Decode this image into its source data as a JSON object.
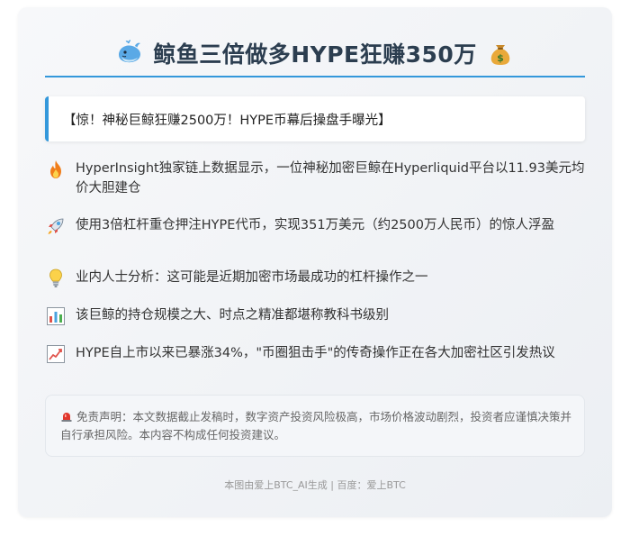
{
  "header": {
    "title": "鲸鱼三倍做多HYPE狂赚350万",
    "left_icon": "whale-icon",
    "right_icon": "money-bag-icon"
  },
  "headline": {
    "text": "【惊！神秘巨鲸狂赚2500万！HYPE币幕后操盘手曝光】"
  },
  "bullets": [
    {
      "icon": "fire-icon",
      "text": "HyperInsight独家链上数据显示，一位神秘加密巨鲸在Hyperliquid平台以11.93美元均价大胆建仓"
    },
    {
      "icon": "rocket-icon",
      "text": "使用3倍杠杆重仓押注HYPE代币，实现351万美元（约2500万人民币）的惊人浮盈"
    },
    {
      "icon": "lightbulb-icon",
      "text": "业内人士分析：这可能是近期加密市场最成功的杠杆操作之一"
    },
    {
      "icon": "bar-chart-icon",
      "text": "该巨鲸的持仓规模之大、时点之精准都堪称教科书级别"
    },
    {
      "icon": "trend-up-chart-icon",
      "text": "HYPE自上市以来已暴涨34%，\"币圈狙击手\"的传奇操作正在各大加密社区引发热议"
    }
  ],
  "disclaimer": {
    "icon": "siren-icon",
    "text": "免责声明：本文数据截止发稿时，数字资产投资风险极高，市场价格波动剧烈，投资者应谨慎决策并自行承担风险。本内容不构成任何投资建议。"
  },
  "footer": {
    "text": "本图由爱上BTC_AI生成 | 百度：爱上BTC"
  },
  "colors": {
    "accent": "#3498db",
    "title": "#2c3e50",
    "body_text": "#333333",
    "muted_text": "#666666"
  }
}
